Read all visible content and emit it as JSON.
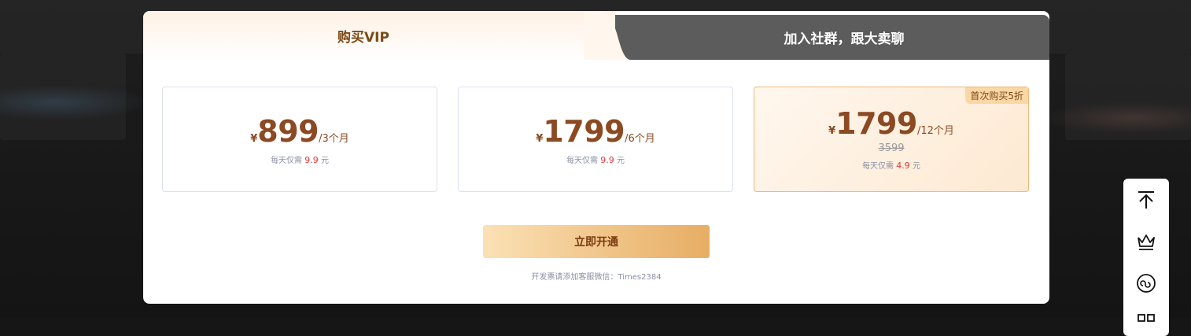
{
  "tabs": [
    {
      "label": "购买VIP",
      "active": true
    },
    {
      "label": "加入社群，跟大卖聊",
      "active": false
    }
  ],
  "plans": [
    {
      "currency": "¥",
      "amount": "899",
      "period": "/3个月",
      "daily_prefix": "每天仅需",
      "daily_value": "9.9",
      "daily_unit": "元"
    },
    {
      "currency": "¥",
      "amount": "1799",
      "period": "/6个月",
      "daily_prefix": "每天仅需",
      "daily_value": "9.9",
      "daily_unit": "元"
    },
    {
      "currency": "¥",
      "amount": "1799",
      "period": "/12个月",
      "original_price": "3599",
      "badge": "首次购买5折",
      "daily_prefix": "每天仅需",
      "daily_value": "4.9",
      "daily_unit": "元",
      "selected": true
    }
  ],
  "cta": {
    "label": "立即开通"
  },
  "invoice_note": "开发票请添加客服微信：Times2384",
  "side_toolbar": {
    "icons": [
      "back-to-top-icon",
      "crown-icon",
      "mini-program-icon",
      "apps-icon"
    ]
  },
  "colors": {
    "brand_brown": "#8b4a23",
    "accent_red": "#e4393c",
    "featured_border": "#f2b877",
    "cta_gradient_start": "#fbe1b5",
    "cta_gradient_end": "#e7ad64"
  }
}
